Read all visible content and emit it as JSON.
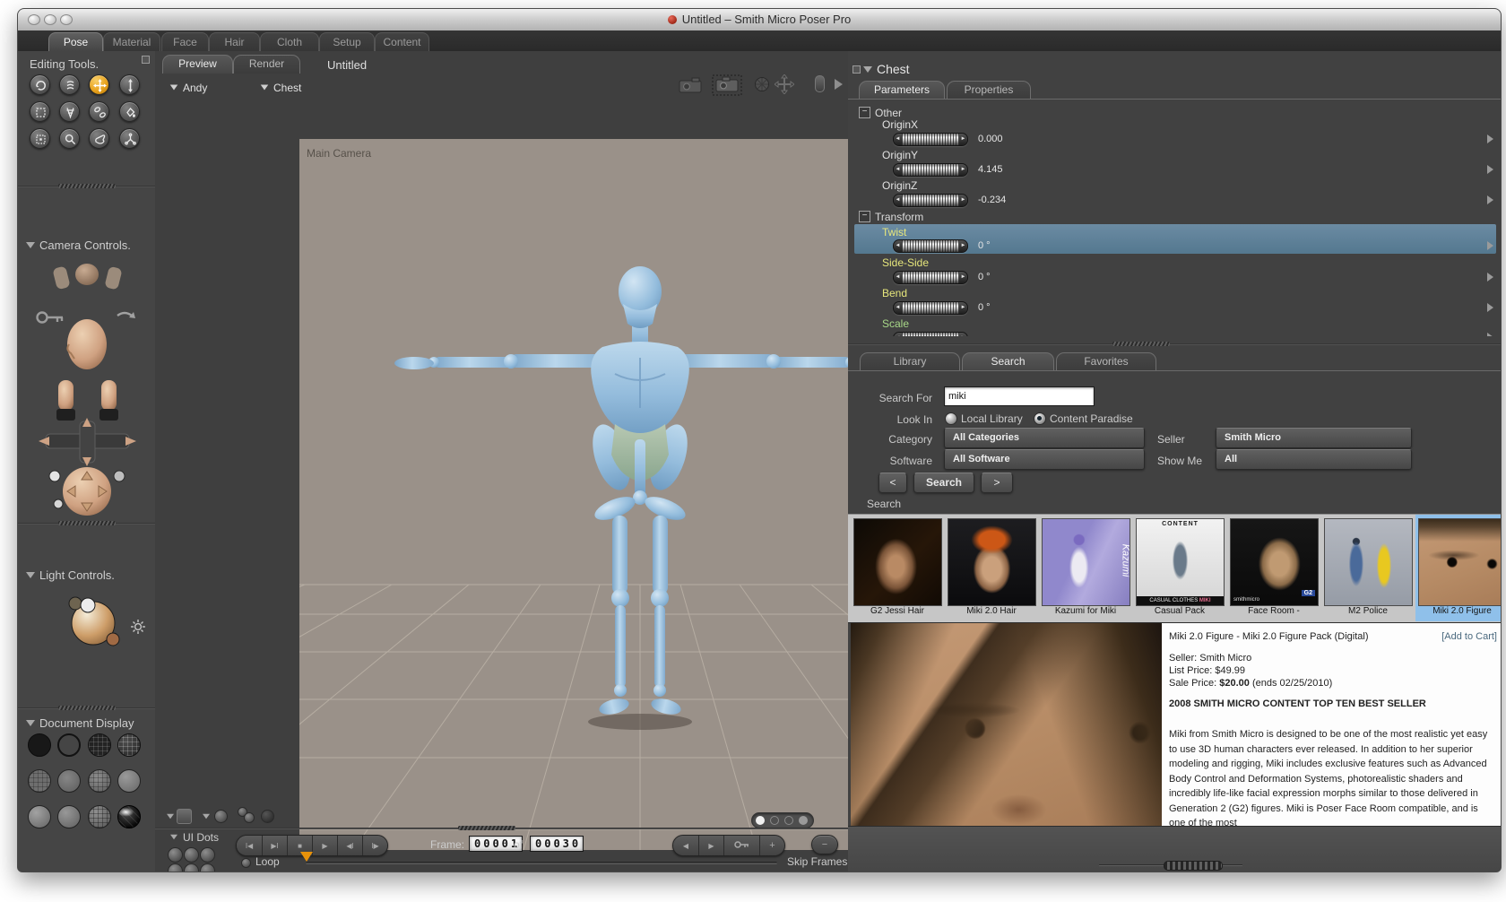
{
  "window": {
    "title": "Untitled – Smith Micro Poser Pro"
  },
  "main_tabs": [
    {
      "label": "Pose"
    },
    {
      "label": "Material"
    },
    {
      "label": "Face"
    },
    {
      "label": "Hair"
    },
    {
      "label": "Cloth"
    },
    {
      "label": "Setup"
    },
    {
      "label": "Content"
    }
  ],
  "sidebar": {
    "editing_tools": {
      "title": "Editing Tools.",
      "tools": [
        "rotate",
        "twist",
        "translate",
        "translate-in-out",
        "scale",
        "taper",
        "chain-break",
        "color",
        "grouping",
        "view-magnifier",
        "morphing-tool",
        "direct-manipulation"
      ],
      "active_tool": "translate"
    },
    "camera_controls": {
      "title": "Camera Controls."
    },
    "light_controls": {
      "title": "Light Controls."
    },
    "document_display": {
      "title": "Document Display",
      "modes": [
        "silhouette",
        "outline",
        "wireframe",
        "hidden-line",
        "lit-wireframe",
        "flat-shaded",
        "flat-lined",
        "cartoon",
        "smooth-shaded",
        "smooth-lined",
        "sketch",
        "texture-shaded"
      ]
    }
  },
  "viewport": {
    "tabs": [
      {
        "label": "Preview"
      },
      {
        "label": "Render"
      }
    ],
    "document_title": "Untitled",
    "actor_dropdown": "Andy",
    "part_dropdown": "Chest",
    "camera_label": "Main Camera"
  },
  "parameters": {
    "panel_title": "Chest",
    "tabs": [
      {
        "label": "Parameters"
      },
      {
        "label": "Properties"
      }
    ],
    "groups": [
      {
        "name": "Other",
        "params": [
          {
            "label": "OriginX",
            "value": "0.000"
          },
          {
            "label": "OriginY",
            "value": "4.145"
          },
          {
            "label": "OriginZ",
            "value": "-0.234"
          }
        ]
      },
      {
        "name": "Transform",
        "params": [
          {
            "label": "Twist",
            "value": "0 °",
            "selected": true
          },
          {
            "label": "Side-Side",
            "value": "0 °"
          },
          {
            "label": "Bend",
            "value": "0 °"
          },
          {
            "label": "Scale",
            "value": ""
          }
        ]
      }
    ]
  },
  "library": {
    "tabs": [
      {
        "label": "Library"
      },
      {
        "label": "Search"
      },
      {
        "label": "Favorites"
      }
    ],
    "search_for_label": "Search For",
    "search_value": "miki",
    "look_in_label": "Look In",
    "local_library_label": "Local Library",
    "content_paradise_label": "Content Paradise",
    "category_label": "Category",
    "category_value": "All Categories",
    "seller_label": "Seller",
    "seller_value": "Smith Micro",
    "software_label": "Software",
    "software_value": "All Software",
    "show_me_label": "Show Me",
    "show_me_value": "All",
    "prev_button": "<",
    "search_button": "Search",
    "next_button": ">",
    "results_label": "Search",
    "results": [
      {
        "label": "G2 Jessi Hair"
      },
      {
        "label": "Miki 2.0 Hair"
      },
      {
        "label": "Kazumi for Miki",
        "overlay_side": "Kazumi"
      },
      {
        "label": "Casual Pack",
        "overlay_top": "CONTENT",
        "overlay_bottom": "CASUAL CLOTHES",
        "overlay_bottom2": "MIKI"
      },
      {
        "label": "Face Room -",
        "overlay_brand": "smithmicro",
        "overlay_badge": "G2"
      },
      {
        "label": "M2 Police"
      },
      {
        "label": "Miki 2.0 Figure",
        "selected": true
      }
    ]
  },
  "product": {
    "title": "Miki 2.0 Figure - Miki 2.0 Figure Pack (Digital)",
    "add_to_cart": "[Add to Cart]",
    "seller": "Seller: Smith Micro",
    "list_price": "List Price: $49.99",
    "sale_price_prefix": "Sale Price: ",
    "sale_price": "$20.00",
    "sale_price_suffix": " (ends 02/25/2010)",
    "banner": "2008 SMITH MICRO CONTENT TOP TEN BEST SELLER",
    "description": "Miki from Smith Micro is designed to be one of the most realistic yet easy to use 3D human characters ever released. In addition to her superior modeling and rigging, Miki includes exclusive features such as Advanced Body Control and Deformation Systems, photorealistic shaders and incredibly life-like facial expression morphs similar to those delivered in Generation 2 (G2) figures. Miki is Poser Face Room compatible, and is one of the most"
  },
  "animation": {
    "ui_dots_label": "UI Dots",
    "frame_label": "Frame:",
    "frame_current": "00001",
    "of_label": "of",
    "frame_total": "00030",
    "loop_label": "Loop",
    "skip_frames_label": "Skip Frames"
  },
  "colors": {
    "accent_orange": "#e8a21c",
    "selection_blue": "#5b7f96",
    "param_yellow": "#e6e67c",
    "param_green": "#a8d888",
    "thumb_selected_blue": "#8fc0ea",
    "canvas_bg": "#9a9189"
  }
}
